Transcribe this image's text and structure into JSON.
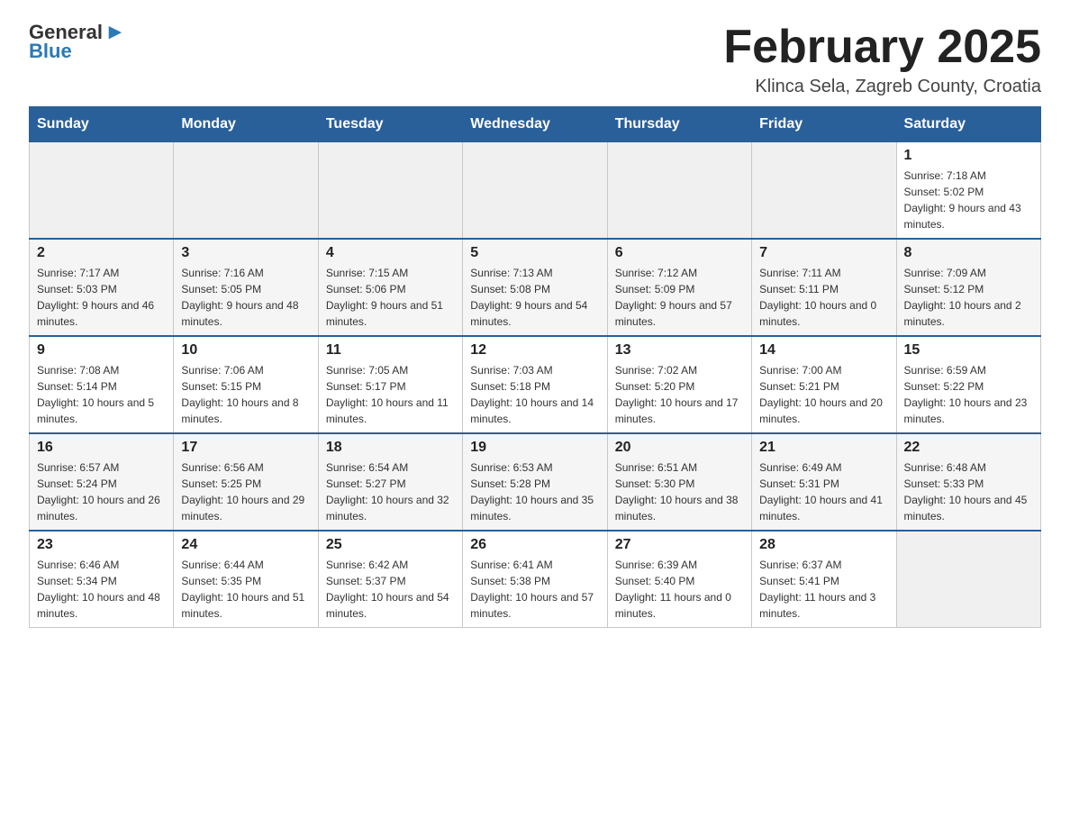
{
  "header": {
    "logo_general": "General",
    "logo_blue": "Blue",
    "title": "February 2025",
    "location": "Klinca Sela, Zagreb County, Croatia"
  },
  "days_of_week": [
    "Sunday",
    "Monday",
    "Tuesday",
    "Wednesday",
    "Thursday",
    "Friday",
    "Saturday"
  ],
  "weeks": [
    [
      {
        "day": "",
        "info": ""
      },
      {
        "day": "",
        "info": ""
      },
      {
        "day": "",
        "info": ""
      },
      {
        "day": "",
        "info": ""
      },
      {
        "day": "",
        "info": ""
      },
      {
        "day": "",
        "info": ""
      },
      {
        "day": "1",
        "info": "Sunrise: 7:18 AM\nSunset: 5:02 PM\nDaylight: 9 hours and 43 minutes."
      }
    ],
    [
      {
        "day": "2",
        "info": "Sunrise: 7:17 AM\nSunset: 5:03 PM\nDaylight: 9 hours and 46 minutes."
      },
      {
        "day": "3",
        "info": "Sunrise: 7:16 AM\nSunset: 5:05 PM\nDaylight: 9 hours and 48 minutes."
      },
      {
        "day": "4",
        "info": "Sunrise: 7:15 AM\nSunset: 5:06 PM\nDaylight: 9 hours and 51 minutes."
      },
      {
        "day": "5",
        "info": "Sunrise: 7:13 AM\nSunset: 5:08 PM\nDaylight: 9 hours and 54 minutes."
      },
      {
        "day": "6",
        "info": "Sunrise: 7:12 AM\nSunset: 5:09 PM\nDaylight: 9 hours and 57 minutes."
      },
      {
        "day": "7",
        "info": "Sunrise: 7:11 AM\nSunset: 5:11 PM\nDaylight: 10 hours and 0 minutes."
      },
      {
        "day": "8",
        "info": "Sunrise: 7:09 AM\nSunset: 5:12 PM\nDaylight: 10 hours and 2 minutes."
      }
    ],
    [
      {
        "day": "9",
        "info": "Sunrise: 7:08 AM\nSunset: 5:14 PM\nDaylight: 10 hours and 5 minutes."
      },
      {
        "day": "10",
        "info": "Sunrise: 7:06 AM\nSunset: 5:15 PM\nDaylight: 10 hours and 8 minutes."
      },
      {
        "day": "11",
        "info": "Sunrise: 7:05 AM\nSunset: 5:17 PM\nDaylight: 10 hours and 11 minutes."
      },
      {
        "day": "12",
        "info": "Sunrise: 7:03 AM\nSunset: 5:18 PM\nDaylight: 10 hours and 14 minutes."
      },
      {
        "day": "13",
        "info": "Sunrise: 7:02 AM\nSunset: 5:20 PM\nDaylight: 10 hours and 17 minutes."
      },
      {
        "day": "14",
        "info": "Sunrise: 7:00 AM\nSunset: 5:21 PM\nDaylight: 10 hours and 20 minutes."
      },
      {
        "day": "15",
        "info": "Sunrise: 6:59 AM\nSunset: 5:22 PM\nDaylight: 10 hours and 23 minutes."
      }
    ],
    [
      {
        "day": "16",
        "info": "Sunrise: 6:57 AM\nSunset: 5:24 PM\nDaylight: 10 hours and 26 minutes."
      },
      {
        "day": "17",
        "info": "Sunrise: 6:56 AM\nSunset: 5:25 PM\nDaylight: 10 hours and 29 minutes."
      },
      {
        "day": "18",
        "info": "Sunrise: 6:54 AM\nSunset: 5:27 PM\nDaylight: 10 hours and 32 minutes."
      },
      {
        "day": "19",
        "info": "Sunrise: 6:53 AM\nSunset: 5:28 PM\nDaylight: 10 hours and 35 minutes."
      },
      {
        "day": "20",
        "info": "Sunrise: 6:51 AM\nSunset: 5:30 PM\nDaylight: 10 hours and 38 minutes."
      },
      {
        "day": "21",
        "info": "Sunrise: 6:49 AM\nSunset: 5:31 PM\nDaylight: 10 hours and 41 minutes."
      },
      {
        "day": "22",
        "info": "Sunrise: 6:48 AM\nSunset: 5:33 PM\nDaylight: 10 hours and 45 minutes."
      }
    ],
    [
      {
        "day": "23",
        "info": "Sunrise: 6:46 AM\nSunset: 5:34 PM\nDaylight: 10 hours and 48 minutes."
      },
      {
        "day": "24",
        "info": "Sunrise: 6:44 AM\nSunset: 5:35 PM\nDaylight: 10 hours and 51 minutes."
      },
      {
        "day": "25",
        "info": "Sunrise: 6:42 AM\nSunset: 5:37 PM\nDaylight: 10 hours and 54 minutes."
      },
      {
        "day": "26",
        "info": "Sunrise: 6:41 AM\nSunset: 5:38 PM\nDaylight: 10 hours and 57 minutes."
      },
      {
        "day": "27",
        "info": "Sunrise: 6:39 AM\nSunset: 5:40 PM\nDaylight: 11 hours and 0 minutes."
      },
      {
        "day": "28",
        "info": "Sunrise: 6:37 AM\nSunset: 5:41 PM\nDaylight: 11 hours and 3 minutes."
      },
      {
        "day": "",
        "info": ""
      }
    ]
  ]
}
